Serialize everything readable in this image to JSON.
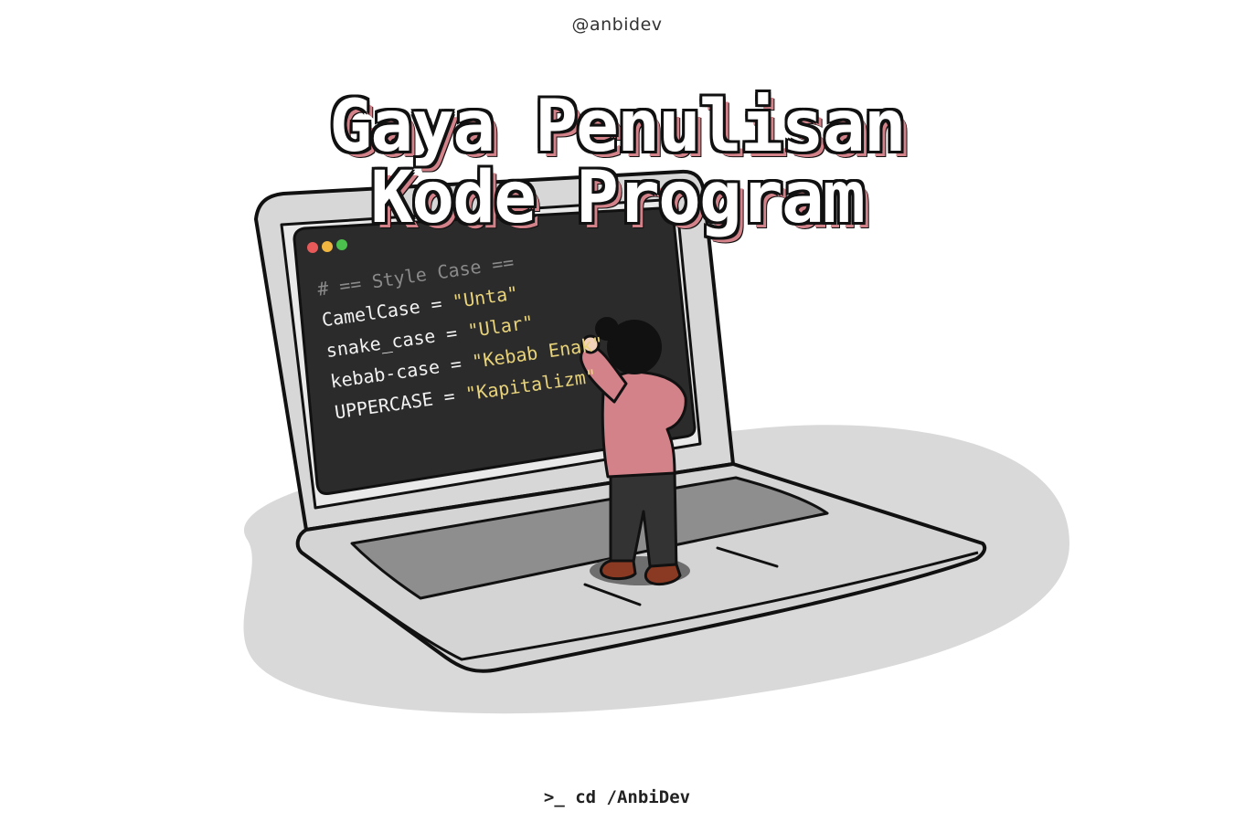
{
  "handle": "@anbidev",
  "title": {
    "line1": "Gaya Penulisan",
    "line2": "Kode Program"
  },
  "code": {
    "comment": "# == Style Case ==",
    "lines": [
      {
        "name": "CamelCase",
        "op": " = ",
        "value": "\"Unta\""
      },
      {
        "name": "snake_case",
        "op": " = ",
        "value": "\"Ular\""
      },
      {
        "name": "kebab-case",
        "op": " = ",
        "value": "\"Kebab Enak\""
      },
      {
        "name": "UPPERCASE",
        "op": " = ",
        "value": "\"Kapitalizm\""
      }
    ]
  },
  "footer": ">_ cd /AnbiDev",
  "colors": {
    "screen": "#2b2b2b",
    "shirt": "#d4828a",
    "string": "#e8d37a",
    "shadow": "#d9d9d9"
  }
}
